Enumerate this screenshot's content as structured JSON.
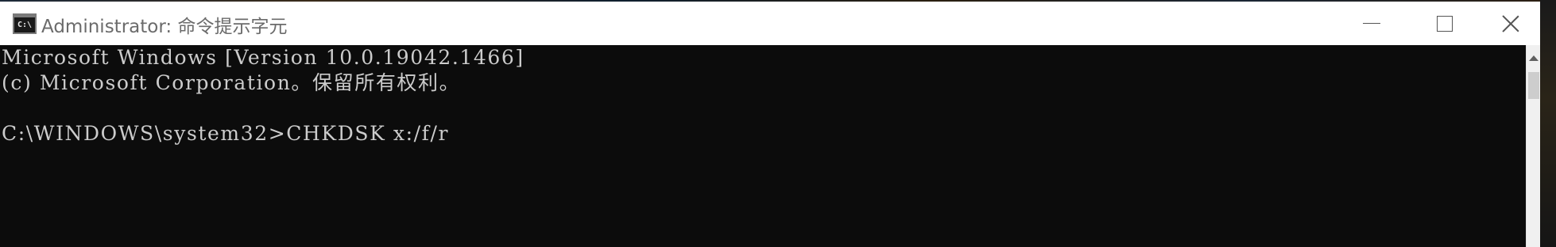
{
  "window": {
    "title": "Administrator: 命令提示字元",
    "icon_label": "C:\\",
    "controls": {
      "minimize": "minimize-icon",
      "maximize": "maximize-icon",
      "close": "close-icon"
    }
  },
  "console": {
    "lines": [
      "Microsoft Windows [Version 10.0.19042.1466]",
      "(c) Microsoft Corporation。保留所有权利。",
      "",
      "C:\\WINDOWS\\system32>CHKDSK x:/f/r"
    ],
    "background_color": "#0c0c0c",
    "text_color": "#cccccc"
  },
  "scrollbar": {
    "up_arrow": "scroll-up-arrow-icon"
  }
}
